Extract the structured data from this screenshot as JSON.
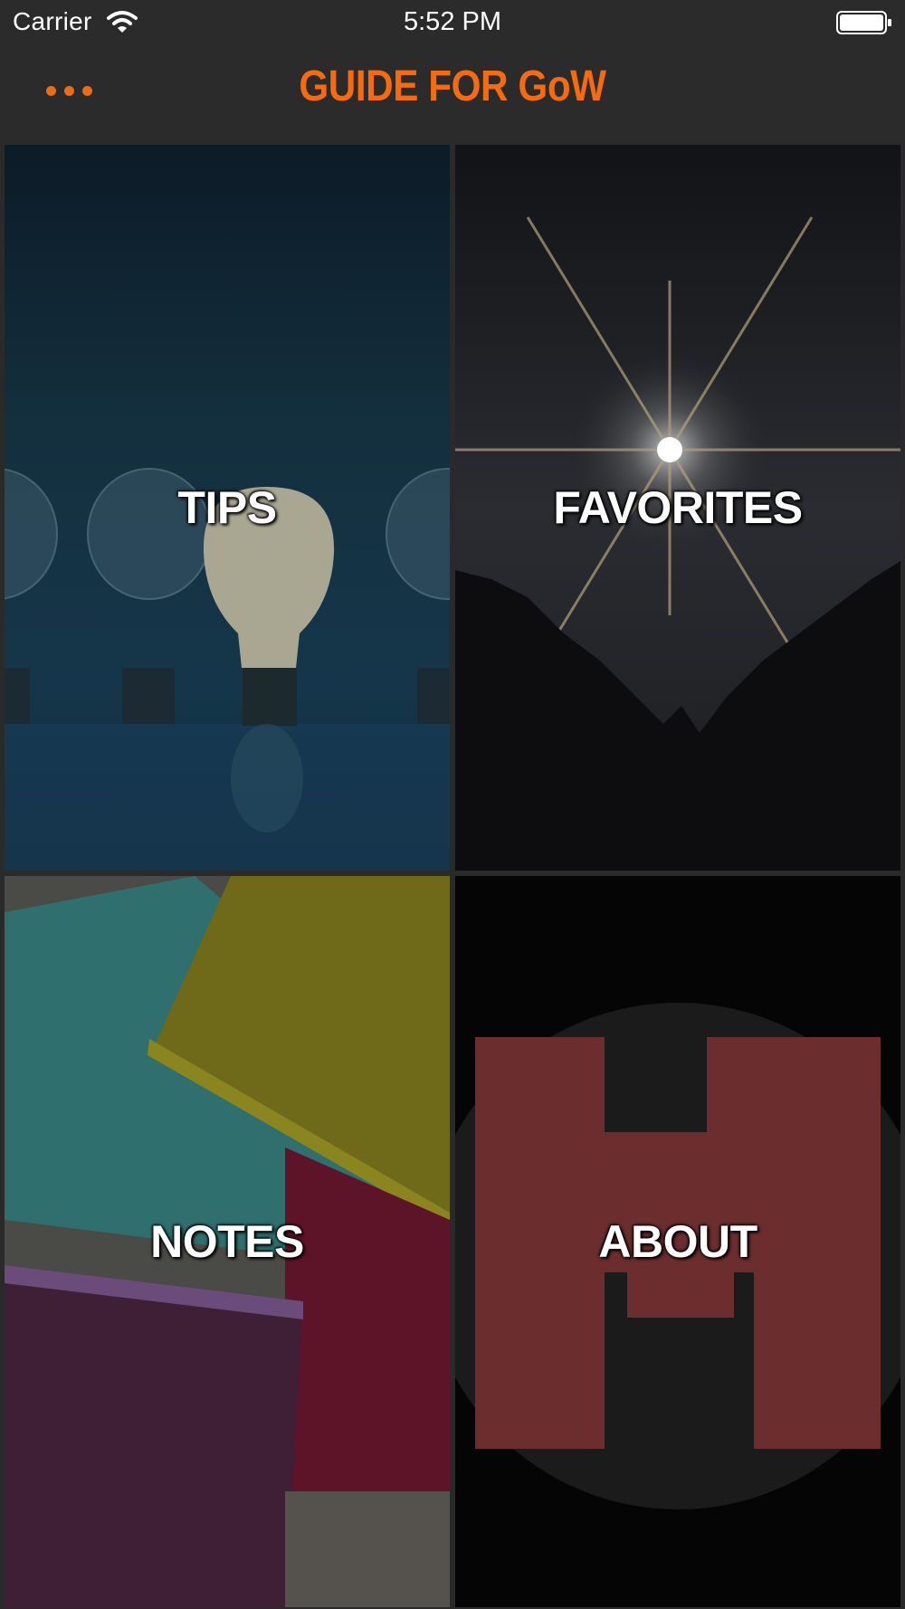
{
  "status_bar": {
    "carrier": "Carrier",
    "time": "5:52 PM",
    "wifi_icon": "wifi-icon",
    "battery_icon": "battery-icon"
  },
  "nav": {
    "title": "GUIDE FOR GoW",
    "menu_icon": "ellipsis-menu-icon",
    "accent_color": "#f56b0e"
  },
  "tiles": [
    {
      "label": "TIPS",
      "image": "lightbulbs-image"
    },
    {
      "label": "FAVORITES",
      "image": "star-over-mountains-image"
    },
    {
      "label": "NOTES",
      "image": "sticky-notes-image"
    },
    {
      "label": "ABOUT",
      "image": "h-logo-image"
    }
  ]
}
